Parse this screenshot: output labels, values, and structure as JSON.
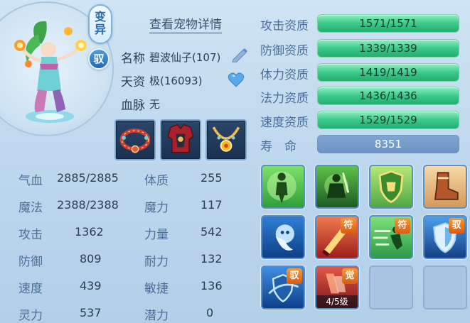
{
  "header": {
    "detail_link": "查看宠物详情",
    "badge_mutation": "变异",
    "badge_tamed": "驭"
  },
  "pet": {
    "name_label": "名称",
    "name_value": "碧波仙子(107)",
    "talent_label": "天资",
    "talent_value": "极(16093)",
    "bloodline_label": "血脉",
    "bloodline_value": "无"
  },
  "equipment": [
    {
      "icon": "red-collar-icon"
    },
    {
      "icon": "red-armor-icon"
    },
    {
      "icon": "gold-necklace-icon"
    }
  ],
  "attributes": {
    "left": [
      {
        "label": "气血",
        "value": "2885/2885"
      },
      {
        "label": "魔法",
        "value": "2388/2388"
      },
      {
        "label": "攻击",
        "value": "1362"
      },
      {
        "label": "防御",
        "value": "809"
      },
      {
        "label": "速度",
        "value": "439"
      },
      {
        "label": "灵力",
        "value": "537"
      }
    ],
    "right": [
      {
        "label": "体质",
        "value": "255"
      },
      {
        "label": "魔力",
        "value": "117"
      },
      {
        "label": "力量",
        "value": "542"
      },
      {
        "label": "耐力",
        "value": "132"
      },
      {
        "label": "敏捷",
        "value": "136"
      },
      {
        "label": "潜力",
        "value": "0"
      }
    ]
  },
  "aptitudes": [
    {
      "label": "攻击资质",
      "value": "1571/1571"
    },
    {
      "label": "防御资质",
      "value": "1339/1339"
    },
    {
      "label": "体力资质",
      "value": "1419/1419"
    },
    {
      "label": "法力资质",
      "value": "1436/1436"
    },
    {
      "label": "速度资质",
      "value": "1529/1529"
    }
  ],
  "life": {
    "label": "寿　命",
    "value": "8351"
  },
  "skills": {
    "tag_fu": "符",
    "tag_yu": "驭",
    "tag_jue": "觉",
    "awaken_level": "4/5级"
  },
  "colors": {
    "aptitude_bar": "#3cc98a",
    "life_bar": "#6c93c2",
    "label_blue": "#4b6f9a",
    "tag_orange": "#e67a22"
  }
}
